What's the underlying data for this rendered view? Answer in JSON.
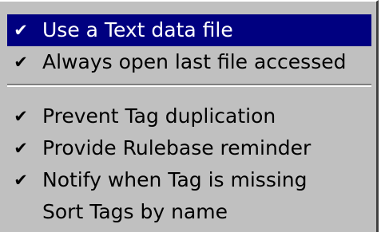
{
  "menu": {
    "selected_color": "#000080",
    "background_color": "#c0c0c0",
    "items": [
      {
        "label": "Use a Text data file",
        "checked": true,
        "check_icon": "✔",
        "selected": true
      },
      {
        "label": "Always open last file accessed",
        "checked": true,
        "check_icon": "✔",
        "selected": false
      },
      {
        "label": "Prevent Tag duplication",
        "checked": true,
        "check_icon": "✔",
        "selected": false
      },
      {
        "label": "Provide Rulebase reminder",
        "checked": true,
        "check_icon": "✔",
        "selected": false
      },
      {
        "label": "Notify when Tag is missing",
        "checked": true,
        "check_icon": "✔",
        "selected": false
      },
      {
        "label": "Sort Tags by name",
        "checked": false,
        "check_icon": "",
        "selected": false
      }
    ]
  }
}
